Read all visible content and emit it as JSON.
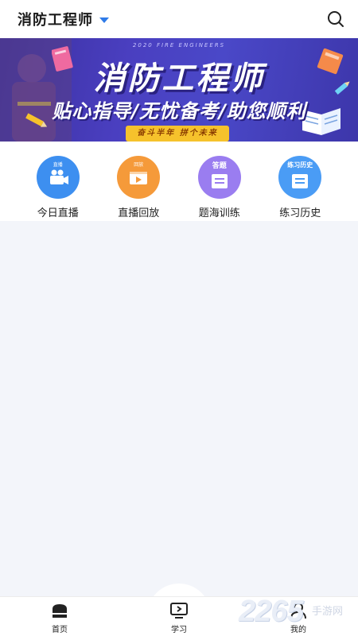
{
  "header": {
    "title": "消防工程师",
    "icons": {
      "dropdown": "caret-down-icon",
      "search": "search-icon"
    },
    "accent": "#2f7be8"
  },
  "banner": {
    "en_subtitle": "2020 FIRE ENGINEERS",
    "title": "消防工程师",
    "slogan": "贴心指导/无忧备考/助您顺利",
    "pill": "奋斗半年  拼个未来",
    "colors": {
      "bg": "#4a3fc0",
      "pill": "#f6c22c"
    }
  },
  "menu": {
    "items": [
      {
        "label": "今日直播",
        "tag": "直播",
        "icon": "live-camera-icon",
        "color": "#3d8ff0"
      },
      {
        "label": "直播回放",
        "tag": "回放",
        "icon": "playback-icon",
        "color": "#f59a3a"
      },
      {
        "label": "题海训练",
        "tag": "答题",
        "icon": "quiz-paper-icon",
        "color": "#9a7df0"
      },
      {
        "label": "练习历史",
        "tag": "练习历史",
        "icon": "history-doc-icon",
        "color": "#4a9cf5"
      }
    ]
  },
  "tabbar": {
    "tabs": [
      {
        "label": "首页",
        "icon": "home-icon"
      },
      {
        "label": "学习",
        "icon": "monitor-play-icon"
      },
      {
        "label": "我的",
        "icon": "user-icon"
      }
    ]
  },
  "watermark": {
    "num": "2265",
    "text": "手游网"
  }
}
